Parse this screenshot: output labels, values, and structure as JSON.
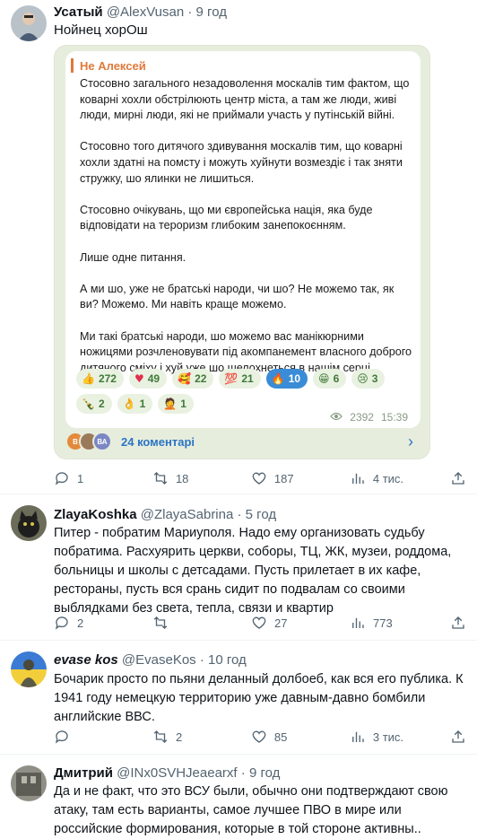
{
  "tweets": [
    {
      "name": "Усатый",
      "handle": "@AlexVusan",
      "separator": "·",
      "time": "9 год",
      "text": "Нойнец хорОш",
      "stats": {
        "replies": "1",
        "retweets": "18",
        "likes": "187",
        "views": "4 тис."
      }
    },
    {
      "name": "ZlayaKoshka",
      "handle": "@ZlayaSabrina",
      "separator": "·",
      "time": "5 год",
      "text": "Питер - побратим Мариуполя. Надо ему организовать судьбу побратима. Расхуярить церкви, соборы, ТЦ, ЖК, музеи, роддома, больницы и школы с детсадами. Пусть прилетает в их кафе, рестораны, пусть вся срань сидит по подвалам со своими выблядками без света, тепла, связи и квартир",
      "stats": {
        "replies": "2",
        "retweets": "",
        "likes": "27",
        "views": "773"
      }
    },
    {
      "name": "evase kos",
      "handle": "@EvaseKos",
      "separator": "·",
      "time": "10 год",
      "text": "Бочарик просто по пьяни деланный долбоеб, как вся его публика. К 1941 году немецкую территорию уже давным-давно бомбили английские ВВС.",
      "stats": {
        "replies": "",
        "retweets": "2",
        "likes": "85",
        "views": "3 тис."
      }
    },
    {
      "name": "Дмитрий",
      "handle": "@INx0SVHJeaearxf",
      "separator": "·",
      "time": "9 год",
      "text": "Да и не факт, что это ВСУ были, обычно они подтверждают свою атаку, там есть варианты, самое лучшее ПВО в мире или российские формирования, которые в той стороне активны.."
    }
  ],
  "telegram": {
    "sender": "Не Алексей",
    "paragraphs": [
      "Стосовно загального незадоволення москалів тим фактом, що коварні хохли обстрілюють центр міста, а там же люди, живі люди, мирні люди, які не приймали участь у путінській війні.",
      "Стосовно того дитячого здивування москалів тим, що коварні хохли здатні на помсту і можуть хуйнути возмездіє і так зняти стружку, шо ялинки не лишиться.",
      "Стосовно очікувань, що ми європейська нація, яка буде відповідати на тероризм глибоким занепокоєнням.",
      "Лише одне питання.",
      "А ми шо, уже не братські народи, чи шо? Не можемо так, як ви? Можемо. Ми навіть краще можемо.",
      "Ми такі братські народи, шо можемо вас манікюрними ножицями розчленовувати під акомпанемент власного доброго дитячого сміху і хуй уже шо шелохнеться в нашім серці."
    ],
    "reactions": [
      {
        "emoji": "👍",
        "count": "272"
      },
      {
        "emoji": "♥",
        "count": "49"
      },
      {
        "emoji": "🥰",
        "count": "22"
      },
      {
        "emoji": "💯",
        "count": "21"
      },
      {
        "emoji": "🔥",
        "count": "10"
      },
      {
        "emoji": "😁",
        "count": "6"
      },
      {
        "emoji": "😢",
        "count": "3"
      },
      {
        "emoji": "🍾",
        "count": "2"
      },
      {
        "emoji": "👌",
        "count": "1"
      },
      {
        "emoji": "🤦",
        "count": "1"
      }
    ],
    "views": "2392",
    "time": "15:39",
    "comment_avatars": [
      "В",
      "",
      "ВА"
    ],
    "comments_label": "24 коментарі",
    "colors": {
      "accent": "#e0793a",
      "link": "#2b74c4"
    }
  }
}
